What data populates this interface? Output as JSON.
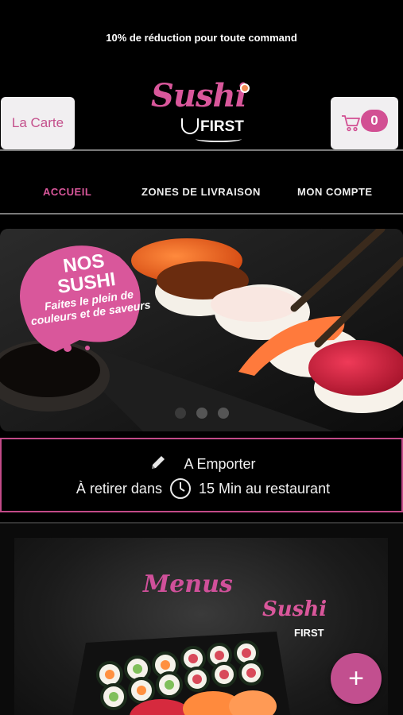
{
  "promo_banner": "10% de réduction pour toute command",
  "header": {
    "menu_button_label": "La Carte",
    "logo": {
      "brand_script": "Sushi",
      "brand_sub": "FIRST"
    },
    "cart": {
      "count": "0",
      "icon": "cart-icon"
    }
  },
  "nav": {
    "items": [
      {
        "label": "ACCUEIL",
        "active": true
      },
      {
        "label": "ZONES DE LIVRAISON",
        "active": false
      },
      {
        "label": "MON COMPTE",
        "active": false
      }
    ]
  },
  "hero": {
    "badge_title_1": "NOS",
    "badge_title_2": "SUSHI",
    "badge_sub_1": "Faites le plein de",
    "badge_sub_2": "couleurs et de saveurs",
    "carousel_count": 3,
    "carousel_active": 0
  },
  "pickup": {
    "mode_label": "A Emporter",
    "prefix": "À retirer dans",
    "time": "15 Min au restaurant",
    "edit_icon": "pencil-icon",
    "time_icon": "clock-icon"
  },
  "category_card": {
    "title": "Menus",
    "logo_script": "Sushi",
    "logo_sub": "FIRST"
  },
  "fab": {
    "label": "+"
  },
  "colors": {
    "accent": "#d9579b",
    "background": "#000000",
    "button_bg": "#f1eff1"
  }
}
